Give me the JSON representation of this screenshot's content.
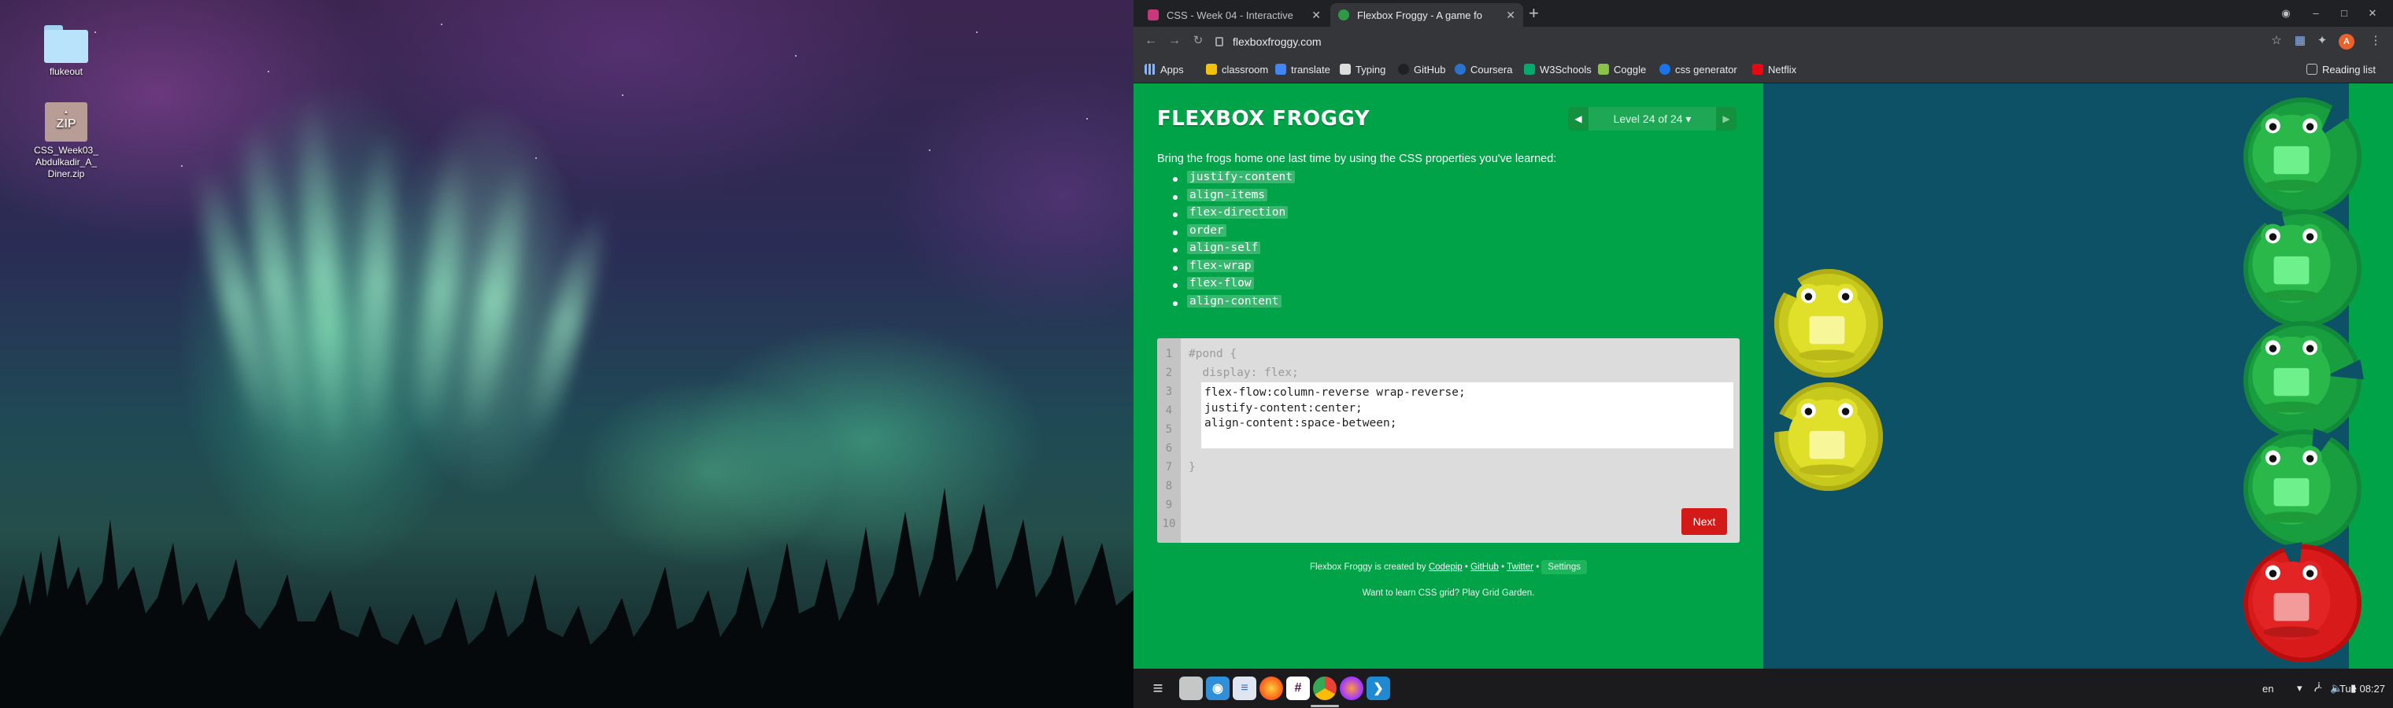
{
  "desktop": {
    "icons": [
      {
        "label": "flukeout"
      },
      {
        "label": "CSS_Week03_\nAbdulkadir_A_\nDiner.zip",
        "badge": "ZIP"
      }
    ]
  },
  "browser": {
    "tabs": [
      {
        "title": "CSS - Week 04 - Interactive",
        "favicon_color": "#c8387a"
      },
      {
        "title": "Flexbox Froggy - A game fo",
        "favicon_color": "#2e9a48"
      }
    ],
    "url": "flexboxfroggy.com",
    "bookmarks": [
      {
        "label": "Apps",
        "color": "#8ab4f8"
      },
      {
        "label": "classroom",
        "color": "#f4c20d"
      },
      {
        "label": "translate",
        "color": "#4285f4"
      },
      {
        "label": "Typing",
        "color": "#dddddd"
      },
      {
        "label": "GitHub",
        "color": "#202124"
      },
      {
        "label": "Coursera",
        "color": "#2a73cc"
      },
      {
        "label": "W3Schools",
        "color": "#04aa6d"
      },
      {
        "label": "Coggle",
        "color": "#8bc34a"
      },
      {
        "label": "css generator",
        "color": "#1a73e8"
      },
      {
        "label": "Netflix",
        "color": "#e50914"
      }
    ],
    "reading_list": "Reading list",
    "profile_initial": "A"
  },
  "game": {
    "logo": "FLEXBOX FROGGY",
    "level": "Level 24 of 24 ▾",
    "instructions": "Bring the frogs home one last time by using the CSS properties you've learned:",
    "properties": [
      "justify-content",
      "align-items",
      "flex-direction",
      "order",
      "align-self",
      "flex-wrap",
      "flex-flow",
      "align-content"
    ],
    "line_numbers": [
      "1",
      "2",
      "3",
      "4",
      "5",
      "6",
      "7",
      "8",
      "9",
      "10"
    ],
    "code_open": "#pond {",
    "code_display": "  display: flex;",
    "code_close": "}",
    "user_code": [
      "flex-flow:column-reverse wrap-reverse;",
      "justify-content:center;",
      "align-content:space-between;"
    ],
    "next_label": "Next",
    "credits": {
      "prefix": "Flexbox Froggy is created by ",
      "codepip": "Codepip",
      "sep1": " • ",
      "github": "GitHub",
      "sep2": " • ",
      "twitter": "Twitter",
      "sep3": " • ",
      "settings": "Settings"
    },
    "grid_prefix": "Want to learn CSS grid? Play ",
    "grid_link": "Grid Garden",
    "grid_suffix": ".",
    "colors": {
      "panel": "#00a347",
      "pond": "#0c5166",
      "green_frog": "#22b14c",
      "yellow_frog": "#d4d62a",
      "red_frog": "#e02020",
      "next": "#d41919"
    }
  },
  "taskbar": {
    "apps": [
      "zorin-menu",
      "files",
      "screenshot",
      "text-editor",
      "firefox",
      "slack",
      "chrome",
      "firefox-dev",
      "vscode"
    ],
    "lang": "en",
    "clock": "Tue 08:27"
  }
}
